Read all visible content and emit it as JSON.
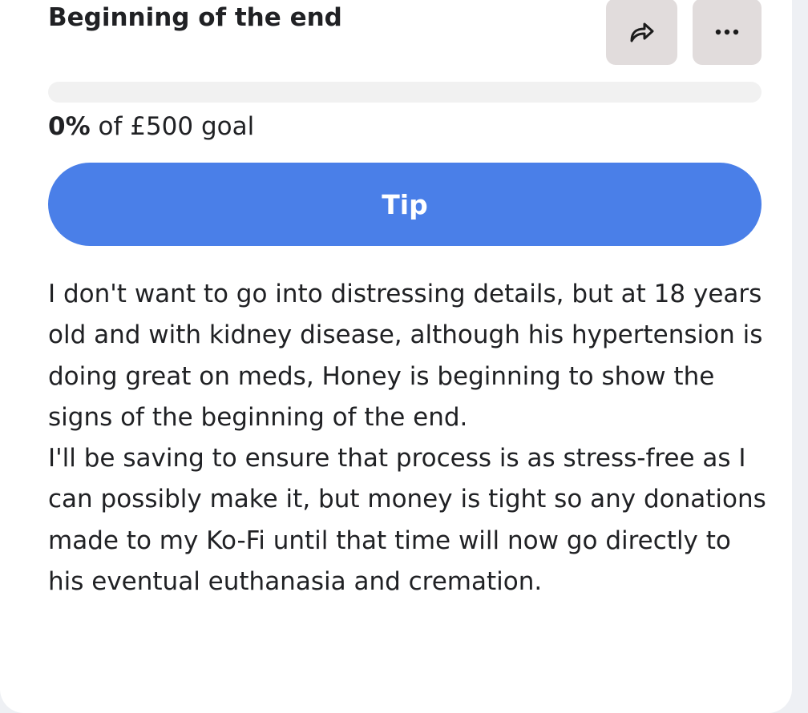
{
  "post": {
    "title": "Beginning of the end"
  },
  "actions": {
    "share_icon": "share-arrow-icon",
    "more_icon": "more-horizontal-icon"
  },
  "goal": {
    "progress_fraction": 0.0,
    "percent_text": "0%",
    "rest_text": " of £500 goal"
  },
  "tip_button": {
    "label": "Tip"
  },
  "description": {
    "paragraph_1": "I don't want to go into distressing details, but at 18 years old and with kidney disease, although his hypertension is doing great on meds, Honey is beginning to show the signs of the beginning of the end.",
    "paragraph_2": "I'll be saving to ensure that process is as stress-free as I can possibly make it, but money is tight so any donations made to my Ko-Fi until that time will now go directly to his eventual euthanasia and cremation."
  },
  "colors": {
    "accent": "#4a7fe8",
    "icon_button_bg": "#e1dcdc",
    "progress_track": "#f1f1f1",
    "text": "#202124",
    "page_bg": "#eef0f4"
  }
}
